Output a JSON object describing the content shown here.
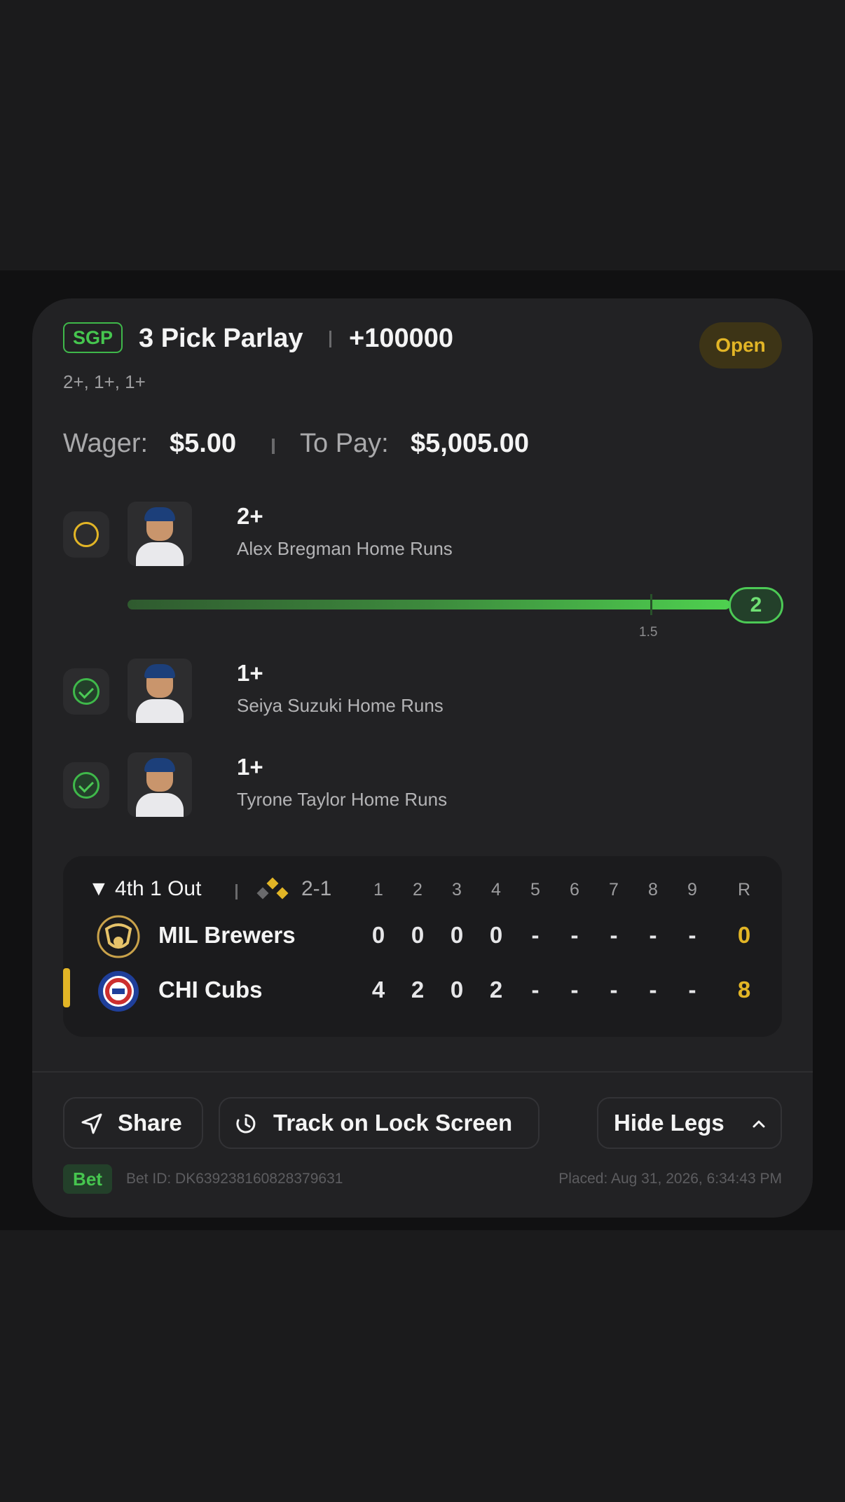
{
  "bet": {
    "type_badge": "SGP",
    "title": "3 Pick Parlay",
    "odds": "+100000",
    "status": "Open",
    "leg_summary": "2+, 1+, 1+",
    "wager_label": "Wager:",
    "wager_value": "$5.00",
    "to_pay_label": "To Pay:",
    "to_pay_value": "$5,005.00"
  },
  "legs": [
    {
      "line": "2+",
      "market": "Alex Bregman Home Runs",
      "status": "open",
      "avatar": "player-photo"
    },
    {
      "line": "1+",
      "market": "Seiya Suzuki Home Runs",
      "status": "won",
      "avatar": "player-photo"
    },
    {
      "line": "1+",
      "market": "Tyrone Taylor Home Runs",
      "status": "won",
      "avatar": "player-photo"
    }
  ],
  "progress": {
    "current": "2",
    "threshold_label": "1.5",
    "fill_fraction": 1.0
  },
  "scoreboard": {
    "game_state": "▼ 4th 1 Out",
    "count": "2-1",
    "innings": [
      "1",
      "2",
      "3",
      "4",
      "5",
      "6",
      "7",
      "8",
      "9"
    ],
    "runs_header": "R",
    "teams": [
      {
        "name": "MIL Brewers",
        "scores": [
          "0",
          "0",
          "0",
          "0",
          "-",
          "-",
          "-",
          "-",
          "-"
        ],
        "runs": "0",
        "batting": false,
        "logo": "brewers-logo"
      },
      {
        "name": "CHI Cubs",
        "scores": [
          "4",
          "2",
          "0",
          "2",
          "-",
          "-",
          "-",
          "-",
          "-"
        ],
        "runs": "8",
        "batting": true,
        "logo": "cubs-logo"
      }
    ]
  },
  "actions": {
    "share": "Share",
    "track": "Track on Lock Screen",
    "hide_legs": "Hide Legs"
  },
  "footer": {
    "bet_tag": "Bet",
    "bet_id": "Bet ID: DK639238160828379631",
    "placed": "Placed: Aug 31, 2026, 6:34:43 PM"
  },
  "colors": {
    "accent_green": "#4cc955",
    "accent_gold": "#e2b526",
    "card_bg": "#222224"
  }
}
